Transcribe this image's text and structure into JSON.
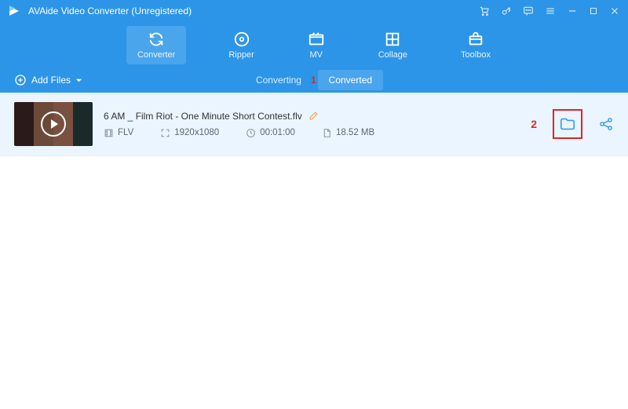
{
  "window": {
    "title": "AVAide Video Converter (Unregistered)"
  },
  "tabs": {
    "converter": "Converter",
    "ripper": "Ripper",
    "mv": "MV",
    "collage": "Collage",
    "toolbox": "Toolbox"
  },
  "subbar": {
    "add_files": "Add Files",
    "converting": "Converting",
    "converted": "Converted"
  },
  "file": {
    "title": "6 AM _ Film Riot - One Minute Short Contest.flv",
    "format": "FLV",
    "resolution": "1920x1080",
    "duration": "00:01:00",
    "size": "18.52 MB"
  },
  "annotations": {
    "step1": "1",
    "step2": "2"
  },
  "colors": {
    "brand": "#2d95e8",
    "highlight": "#e32424"
  }
}
